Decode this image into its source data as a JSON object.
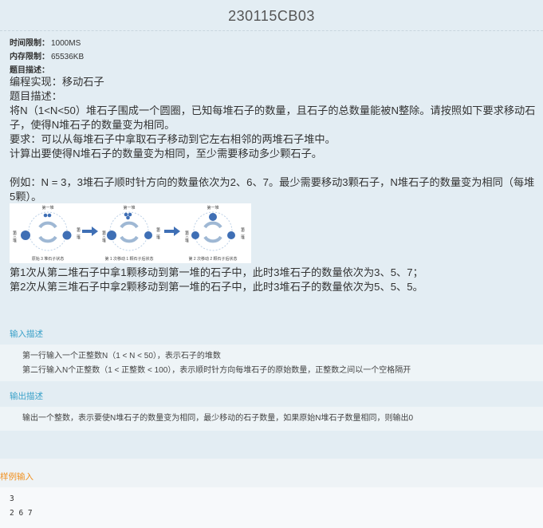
{
  "problem": {
    "title": "230115CB03",
    "meta": [
      {
        "key": "时间限制：",
        "value": "1000MS"
      },
      {
        "key": "内存限制：",
        "value": "65536KB"
      },
      {
        "key": "题目描述：",
        "value": ""
      }
    ],
    "desc": [
      "编程实现：移动石子",
      "题目描述：",
      "将N（1<N<50）堆石子围成一个圆圈，已知每堆石子的数量，且石子的总数量能被N整除。请按照如下要求移动石子，使得N堆石子的数量变为相同。",
      "要求：可以从每堆石子中拿取石子移动到它左右相邻的两堆石子堆中。",
      "计算出要使得N堆石子的数量变为相同，至少需要移动多少颗石子。",
      "",
      "例如：N = 3，3堆石子顺时针方向的数量依次为2、6、7。最少需要移动3颗石子，N堆石子的数量变为相同（每堆5颗）。"
    ],
    "figure": {
      "top_label": "第一堆",
      "left_label": "第三堆",
      "right_label": "第二堆",
      "captions": [
        "原始 3 堆石子状态",
        "第 1 次移动 1 颗石子后状态",
        "第 2 次移动 2 颗石子后状态"
      ]
    },
    "desc_after": [
      "第1次从第二堆石子中拿1颗移动到第一堆的石子中，此时3堆石子的数量依次为3、5、7；",
      "第2次从第三堆石子中拿2颗移动到第一堆的石子中，此时3堆石子的数量依次为5、5、5。"
    ]
  },
  "input": {
    "heading": "输入描述",
    "lines": [
      "第一行输入一个正整数N（1 < N < 50），表示石子的堆数",
      "第二行输入N个正整数（1 < 正整数 < 100），表示顺时针方向每堆石子的原始数量，正整数之间以一个空格隔开"
    ]
  },
  "output": {
    "heading": "输出描述",
    "lines": [
      "输出一个整数，表示要使N堆石子的数量变为相同，最少移动的石子数量，如果原始N堆石子数量相同，则输出0"
    ]
  },
  "sample": {
    "heading": "样例输入",
    "lines": [
      "3",
      "2 6 7"
    ]
  },
  "colors": {
    "accent": "#3aa1c9",
    "sample_heading": "#f0901f",
    "stone": "#3f6fb5"
  }
}
